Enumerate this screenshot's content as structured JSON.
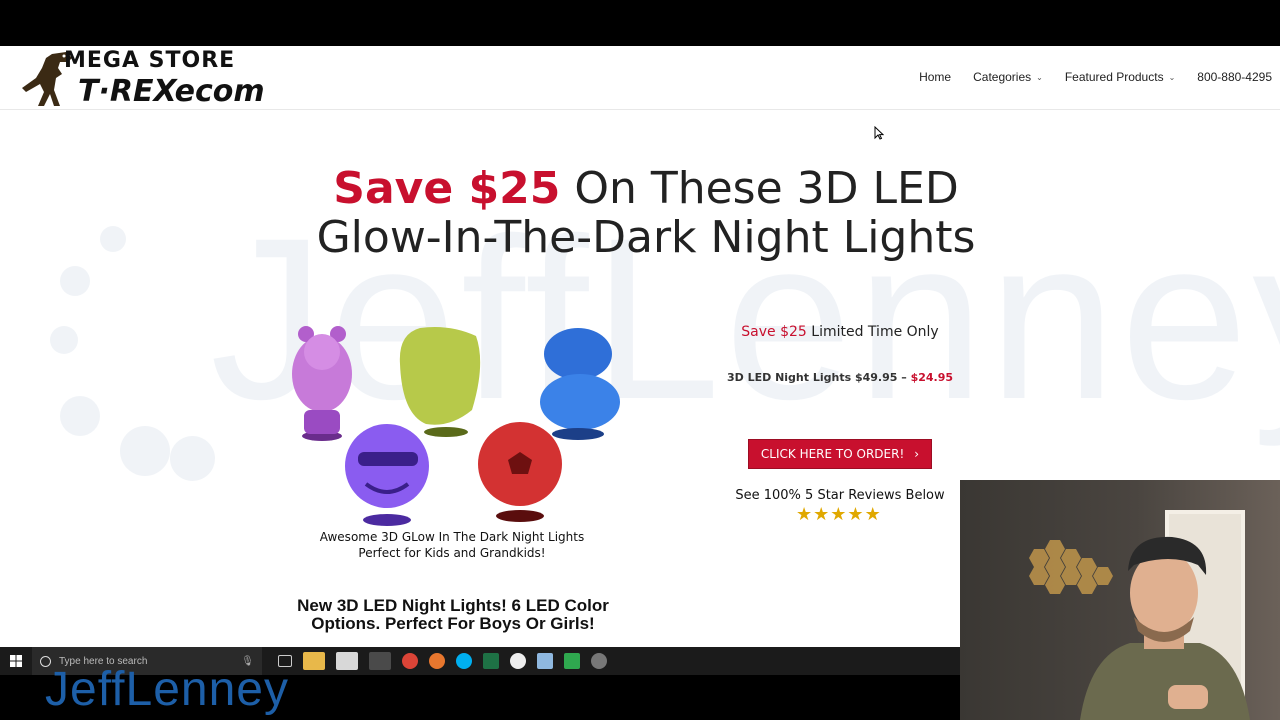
{
  "header": {
    "logo_top": "MEGA STORE",
    "logo_bottom": "T·REXecom",
    "nav": [
      {
        "label": "Home",
        "dropdown": false
      },
      {
        "label": "Categories",
        "dropdown": true
      },
      {
        "label": "Featured Products",
        "dropdown": true
      },
      {
        "label": "800-880-4295",
        "dropdown": false
      }
    ]
  },
  "hero": {
    "headline_red": "Save $25",
    "headline_rest_1": " On These 3D LED",
    "headline_rest_2": "Glow-In-The-Dark Night Lights"
  },
  "product": {
    "caption_line1": "Awesome 3D GLow In The Dark Night Lights",
    "caption_line2": "Perfect for Kids and Grandkids!",
    "subhead_line1": "New 3D LED Night Lights! 6 LED Color",
    "subhead_line2": "Options. Perfect For Boys Or Girls!"
  },
  "offer": {
    "save_red": "Save $25",
    "save_rest": " Limited Time Only",
    "price_label": "3D LED Night Lights $49.95 – ",
    "price_sale": "$24.95",
    "button_label": "CLICK HERE TO ORDER!",
    "button_arrow": "›",
    "reviews_text": "See 100% 5 Star Reviews Below",
    "stars": 5
  },
  "taskbar": {
    "search_placeholder": "Type here to search"
  },
  "overlay": {
    "brand": "JeffLenney"
  },
  "colors": {
    "accent_red": "#c8102e",
    "star": "#e0a800",
    "taskbar": "#1b1b1b"
  }
}
